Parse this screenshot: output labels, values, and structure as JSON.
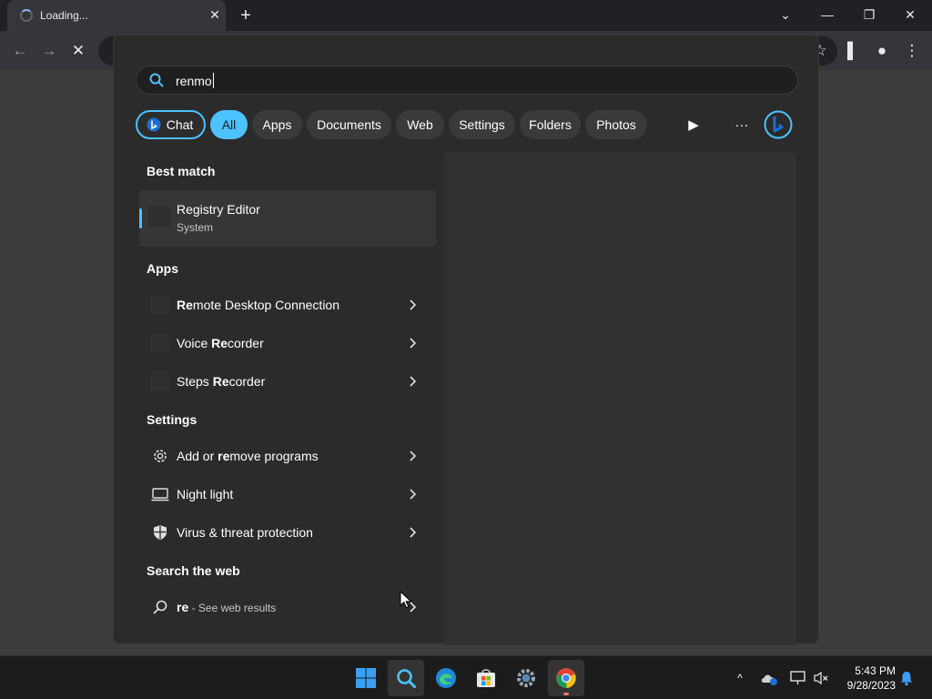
{
  "browser": {
    "tab_title": "Loading...",
    "tab_close": "✕",
    "new_tab": "+",
    "window_controls": {
      "tab_search": "⌄",
      "minimize": "—",
      "restore": "❐",
      "close": "✕"
    },
    "toolbar": {
      "back": "←",
      "forward": "→",
      "stop": "✕",
      "star": "☆",
      "side_panel": "▌",
      "profile": "●",
      "menu": "⋮"
    }
  },
  "search": {
    "query": "renmo",
    "chips": {
      "chat": "Chat",
      "all": "All",
      "apps": "Apps",
      "documents": "Documents",
      "web": "Web",
      "settings": "Settings",
      "folders": "Folders",
      "photos": "Photos"
    },
    "more_play": "▶",
    "more_options": "···",
    "best_match": {
      "heading": "Best match",
      "title": "Registry Editor",
      "subtitle": "System"
    },
    "apps": {
      "heading": "Apps",
      "items": [
        {
          "bold": "Re",
          "rest": "mote Desktop Connection"
        },
        {
          "pre": "Voice ",
          "bold": "Re",
          "rest": "corder"
        },
        {
          "pre": "Steps ",
          "bold": "Re",
          "rest": "corder"
        }
      ]
    },
    "settings": {
      "heading": "Settings",
      "items": [
        {
          "pre": "Add or ",
          "bold": "re",
          "rest": "move programs",
          "icon": "gear-icon"
        },
        {
          "label": "Night light",
          "icon": "monitor-icon"
        },
        {
          "label": "Virus & threat protection",
          "icon": "shield-icon"
        }
      ]
    },
    "web": {
      "heading": "Search the web",
      "term": "re",
      "suffix": " - See web results"
    }
  },
  "taskbar": {
    "apps": [
      "start-icon",
      "search-icon",
      "edge-icon",
      "store-icon",
      "settings-icon",
      "chrome-icon"
    ],
    "tray": {
      "chevron": "^",
      "time": "5:43 PM",
      "date": "9/28/2023"
    }
  },
  "colors": {
    "accent": "#4cc2ff",
    "panel": "#2b2b2b",
    "chip": "#3a3a3a"
  }
}
